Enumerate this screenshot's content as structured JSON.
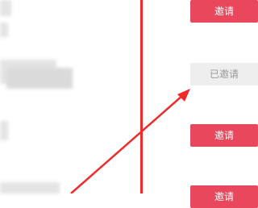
{
  "colors": {
    "accent": "#e8475c",
    "annotation": "#ee2a2a",
    "disabled_bg": "#eeeeee",
    "disabled_text": "#9a9a9a"
  },
  "invite_list": [
    {
      "label": "邀请",
      "state": "active"
    },
    {
      "label": "已邀请",
      "state": "invited"
    },
    {
      "label": "邀请",
      "state": "active"
    },
    {
      "label": "邀请",
      "state": "active"
    }
  ],
  "annotation": {
    "type": "arrow",
    "points_to": "invite-button-2"
  }
}
